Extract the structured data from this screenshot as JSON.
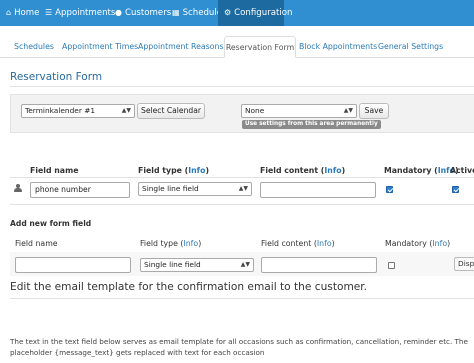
{
  "nav": {
    "home": "Home",
    "appointments": "Appointments",
    "customers": "Customers",
    "schedule": "Schedule",
    "configuration": "Configuration"
  },
  "tabs": [
    {
      "label": "Schedules"
    },
    {
      "label": "Appointment Times"
    },
    {
      "label": "Appointment Reasons"
    },
    {
      "label": "Reservation Form"
    },
    {
      "label": "Block Appointments"
    },
    {
      "label": "General Settings"
    }
  ],
  "section_title": "Reservation Form",
  "calendar": {
    "selected": "Terminkalender #1",
    "select_button": "Select Calendar",
    "settings_selected": "None",
    "save_button": "Save",
    "permanent_badge": "Use settings from this area permanently"
  },
  "table_headers": {
    "field_name": "Field name",
    "field_type": "Field type",
    "field_content": "Field content",
    "mandatory": "Mandatory",
    "active": "Active",
    "info": "Info",
    "open_paren": "(",
    "close_paren": ")"
  },
  "field_row": {
    "name": "phone number",
    "type": "Single line field",
    "content": "",
    "mandatory": true,
    "active": true
  },
  "new_field": {
    "title": "Add new form field",
    "name": "",
    "type": "Single line field",
    "content": "",
    "mandatory": false,
    "display_button": "Disp"
  },
  "email": {
    "title": "Edit the email template for the confirmation email to the customer.",
    "description": "The text in the text field below serves as email template for all occasions such as confirmation, cancellation, reminder etc. The placeholder {message_text} gets replaced with text for each occasion"
  },
  "colors": {
    "nav_bg": "#2f8fd0",
    "nav_active": "#1c6aa0",
    "link": "#2a7ab8",
    "title": "#2a6a9c"
  }
}
